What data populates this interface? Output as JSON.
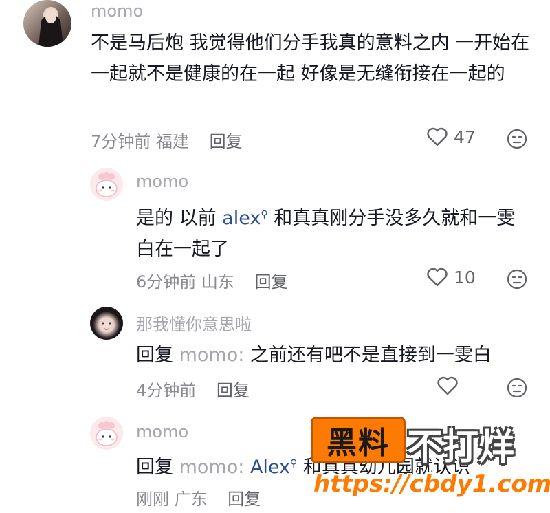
{
  "comments": [
    {
      "username": "momo",
      "text": "不是马后炮 我觉得他们分手我真的意料之内 一开始在一起就不是健康的在一起 好像是无缝衔接在一起的",
      "time": "7分钟前",
      "location": "福建",
      "reply_label": "回复",
      "likes": "47"
    },
    {
      "username": "momo",
      "text_before": "是的 以前 ",
      "mention": "alex",
      "text_after": " 和真真刚分手没多久就和一雯白在一起了",
      "time": "6分钟前",
      "location": "山东",
      "reply_label": "回复",
      "likes": "10"
    },
    {
      "username": "那我懂你意思啦",
      "reply_prefix": "回复",
      "reply_to": "momo:",
      "text": "之前还有吧不是直接到一雯白",
      "time": "4分钟前",
      "reply_label": "回复"
    },
    {
      "username": "momo",
      "reply_prefix": "回复",
      "reply_to": "momo:",
      "mention": "Alex",
      "text_after": "和真真幼儿园就认识",
      "time": "刚刚",
      "location": "广东",
      "reply_label": "回复"
    }
  ],
  "watermark": {
    "badge": "黑料",
    "slogan": "不打烊",
    "url": "https://cbdy1.com"
  },
  "colors": {
    "accent": "#ff7a00",
    "mention": "#2a4f8e"
  }
}
